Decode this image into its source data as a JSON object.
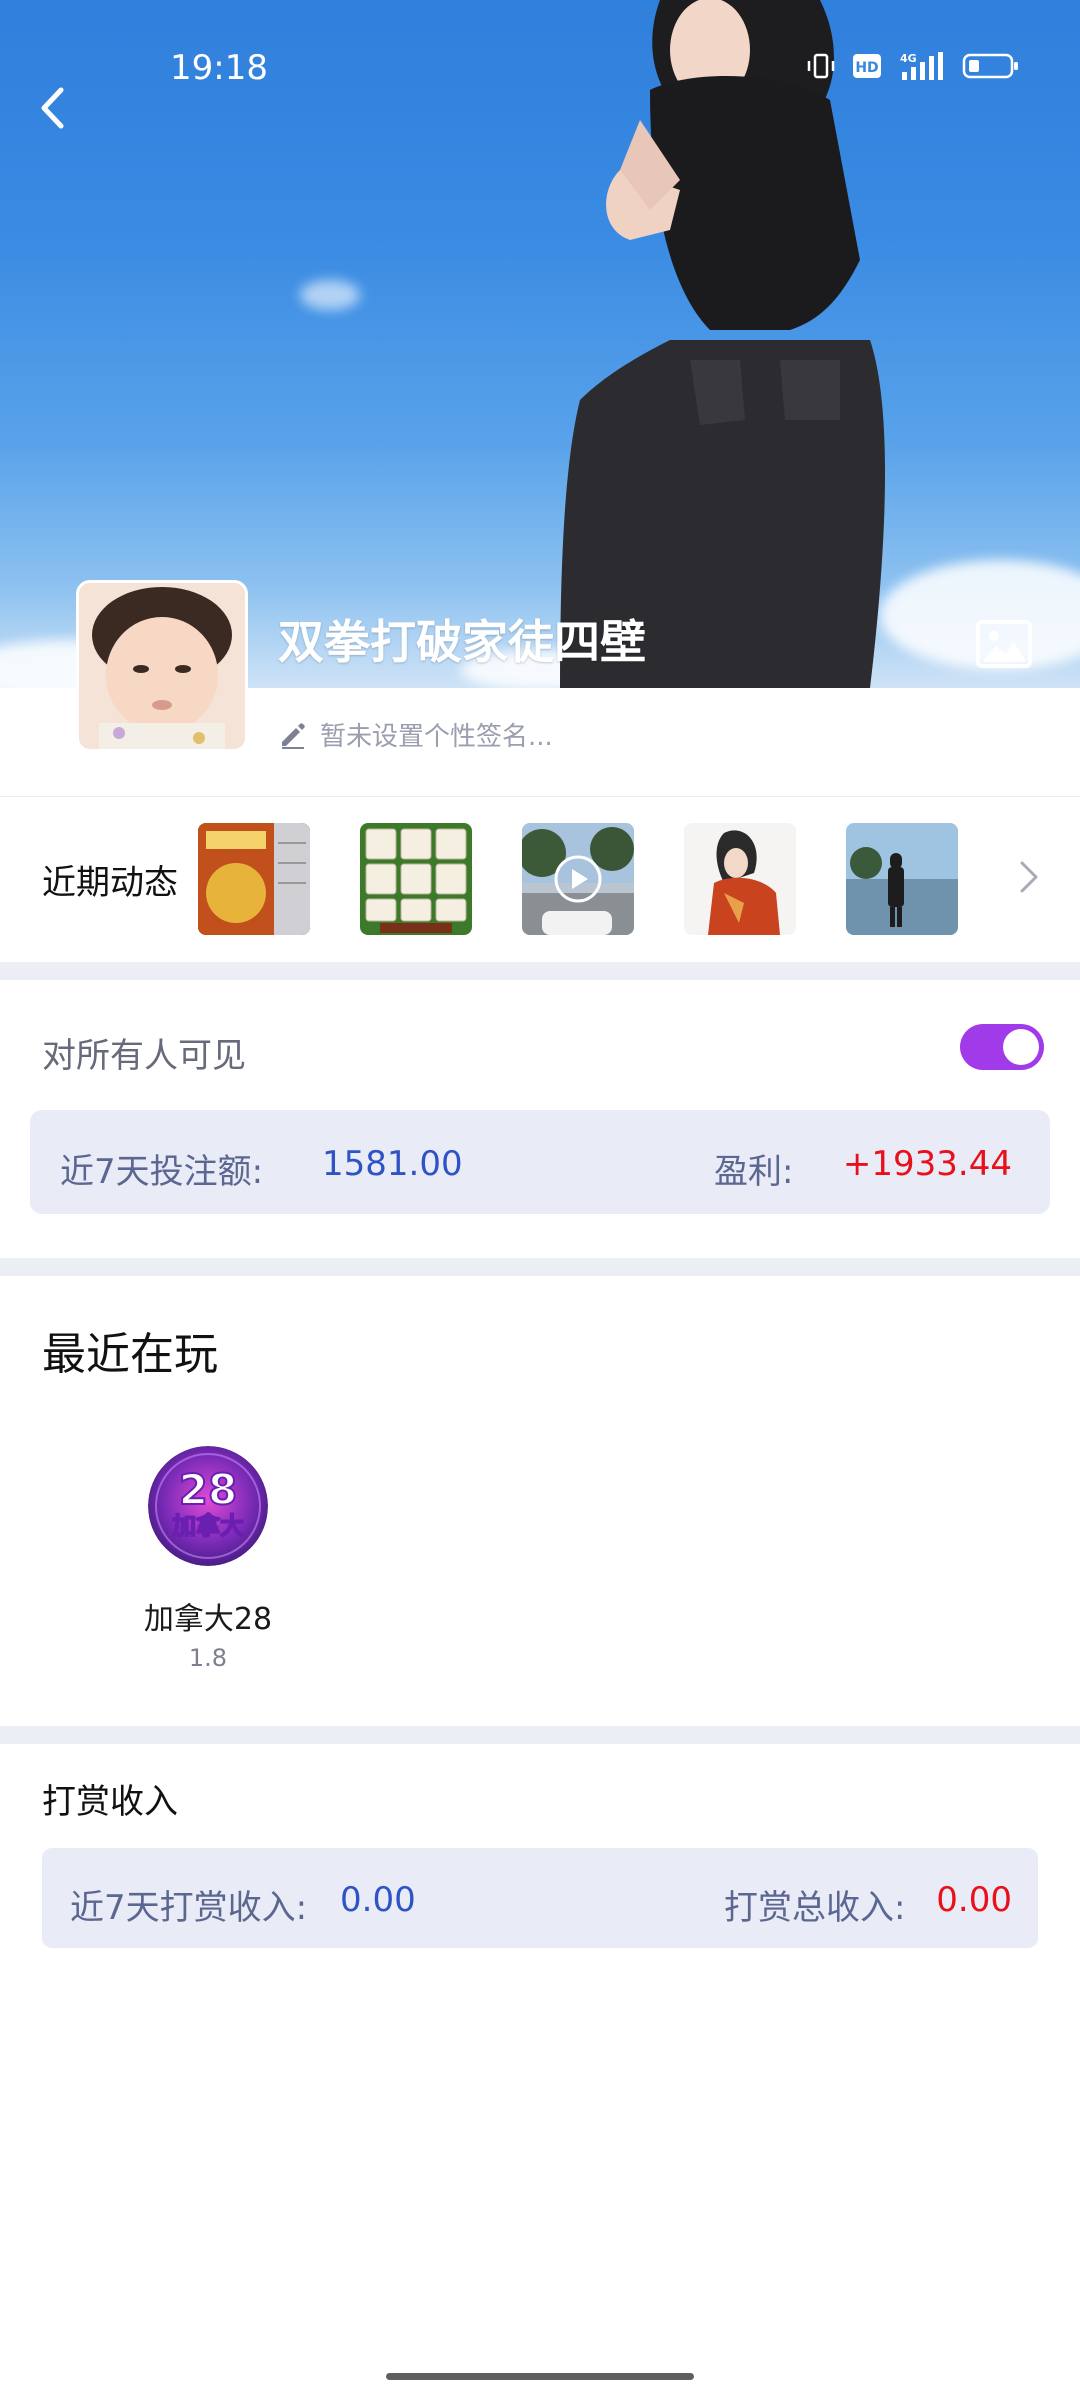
{
  "status_bar": {
    "time": "19:18",
    "icons": [
      "vibrate-icon",
      "hd-icon",
      "4g-signal-icon",
      "battery-icon"
    ]
  },
  "profile": {
    "username": "双拳打破家徒四壁",
    "signature_placeholder": "暂未设置个性签名..."
  },
  "moments": {
    "title": "近期动态",
    "thumbnails": [
      "game-win-screenshot-1",
      "mahjong-screenshot",
      "video-thumbnail",
      "portrait-photo-1",
      "portrait-photo-2"
    ]
  },
  "visibility": {
    "label": "对所有人可见",
    "enabled": true
  },
  "stats": {
    "bet_label": "近7天投注额:",
    "bet_value": "1581.00",
    "profit_label": "盈利:",
    "profit_value": "+1933.44"
  },
  "recent_games": {
    "title": "最近在玩",
    "items": [
      {
        "name": "加拿大28",
        "version": "1.8",
        "icon_text": "28",
        "icon_subtext": "加拿大"
      }
    ]
  },
  "reward": {
    "title": "打赏收入",
    "week_label": "近7天打赏收入:",
    "week_value": "0.00",
    "total_label": "打赏总收入:",
    "total_value": "0.00"
  },
  "colors": {
    "accent": "#a13ae8",
    "value_blue": "#2f53c4",
    "value_red": "#e8101a",
    "card_bg": "#e9ecf6"
  }
}
